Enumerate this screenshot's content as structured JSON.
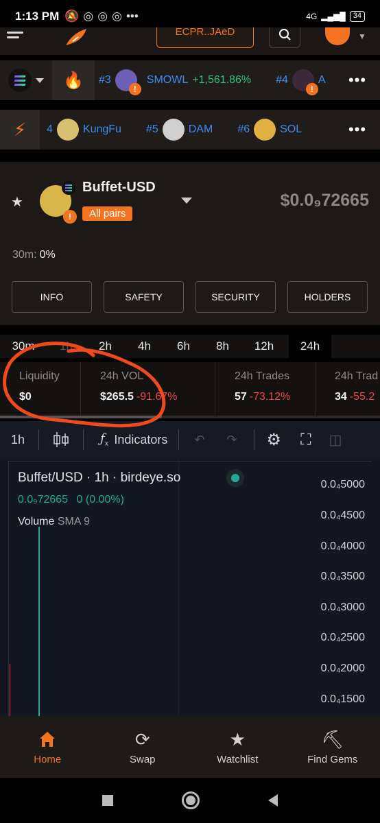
{
  "status_bar": {
    "time": "1:13 PM",
    "network": "4G",
    "battery": "34"
  },
  "header": {
    "wallet_address": "ECPR..JAeD"
  },
  "trending": {
    "items": [
      {
        "rank": "#3",
        "name": "SMOWL",
        "change": "+1,561.86%"
      },
      {
        "rank": "#4",
        "name": "A"
      }
    ]
  },
  "gems": {
    "items": [
      {
        "rank": "4",
        "name": "KungFu"
      },
      {
        "rank": "#5",
        "name": "DAM"
      },
      {
        "rank": "#6",
        "name": "SOL"
      }
    ]
  },
  "pair": {
    "name": "Buffet-USD",
    "badge": "All pairs",
    "price": "$0.0₉72665",
    "change_label": "30m:",
    "change_value": "0%",
    "buttons": [
      "INFO",
      "SAFETY",
      "SECURITY",
      "HOLDERS"
    ]
  },
  "timeframes": [
    "30m",
    "1h",
    "2h",
    "4h",
    "6h",
    "8h",
    "12h",
    "24h"
  ],
  "timeframe_selected": "24h",
  "stats": [
    {
      "label": "Liquidity",
      "value": "$0",
      "change": ""
    },
    {
      "label": "24h VOL",
      "value": "$265.5",
      "change": "-91.67%"
    },
    {
      "label": "24h Trades",
      "value": "57",
      "change": "-73.12%"
    },
    {
      "label": "24h Trad",
      "value": "34",
      "change": "-55.2"
    }
  ],
  "chart_toolbar": {
    "interval": "1h",
    "indicators_label": "Indicators"
  },
  "chart": {
    "legend_title": "Buffet/USD · 1h · birdeye.so",
    "legend_price": "0.0₉72665",
    "legend_change": "0 (0.00%)",
    "volume_label": "Volume",
    "volume_indicator": "SMA 9",
    "y_ticks": [
      "0.0₄5000",
      "0.0₄4500",
      "0.0₄4000",
      "0.0₄3500",
      "0.0₄3000",
      "0.0₄2500",
      "0.0₄2000",
      "0.0₄1500"
    ]
  },
  "bottom_nav": [
    {
      "label": "Home",
      "icon": "home-icon"
    },
    {
      "label": "Swap",
      "icon": "swap-icon"
    },
    {
      "label": "Watchlist",
      "icon": "star-icon"
    },
    {
      "label": "Find Gems",
      "icon": "pickaxe-icon"
    }
  ],
  "colors": {
    "accent": "#f47321",
    "positive": "#2ec27e",
    "negative": "#f0454b",
    "link": "#3d8cf0"
  }
}
